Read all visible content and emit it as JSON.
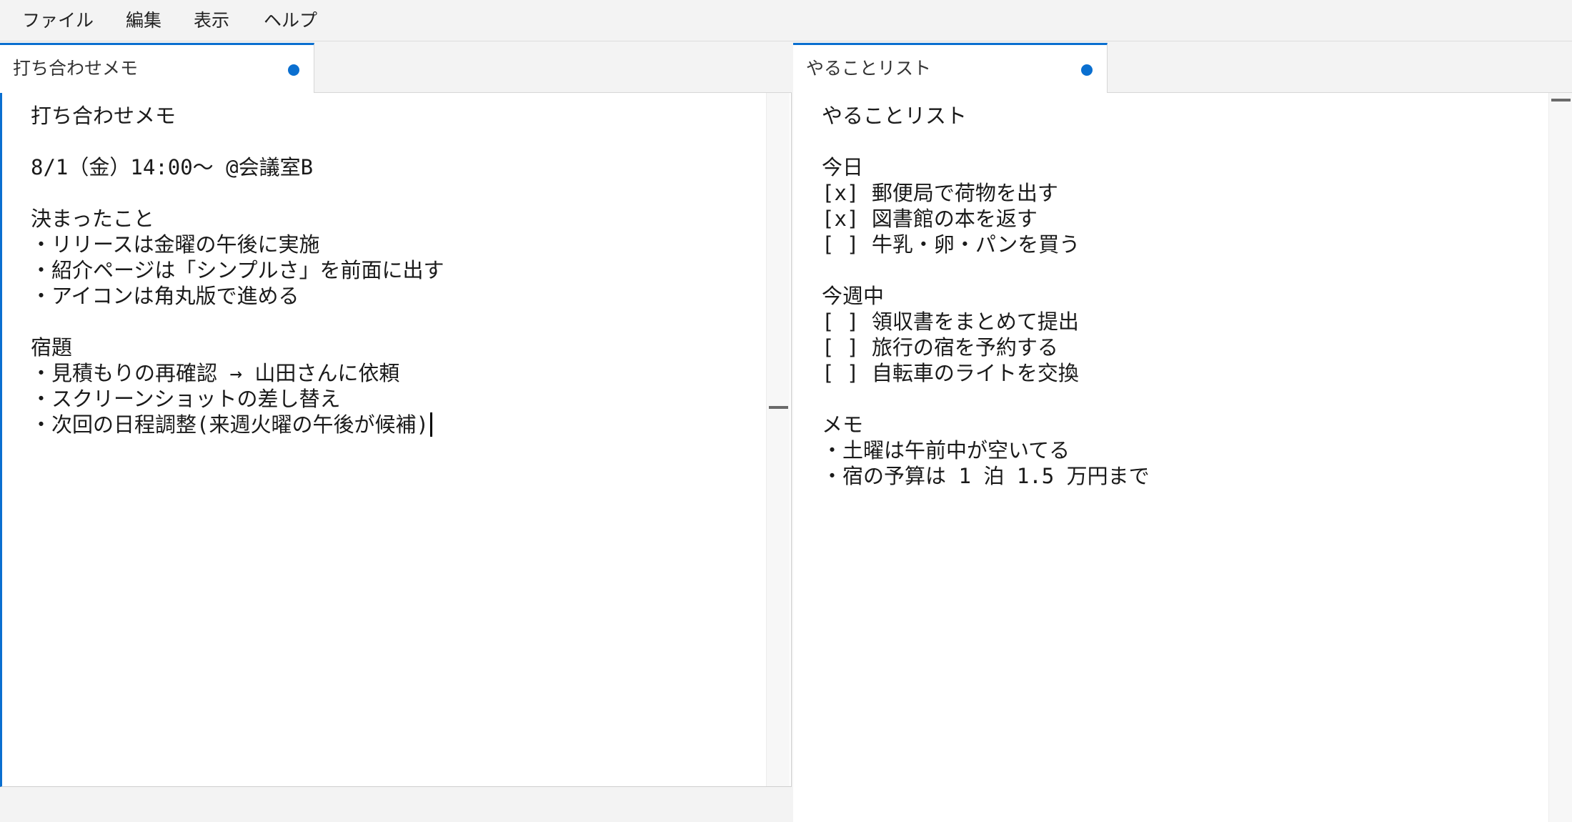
{
  "menu": {
    "file": "ファイル",
    "edit": "編集",
    "view": "表示",
    "help": "ヘルプ"
  },
  "left_pane": {
    "tab_label": "打ち合わせメモ",
    "unsaved": true,
    "content": "打ち合わせメモ\n\n8/1（金）14:00〜 @会議室B\n\n決まったこと\n・リリースは金曜の午後に実施\n・紹介ページは「シンプルさ」を前面に出す\n・アイコンは角丸版で進める\n\n宿題\n・見積もりの再確認 → 山田さんに依頼\n・スクリーンショットの差し替え\n・次回の日程調整(来週火曜の午後が候補)"
  },
  "right_pane": {
    "tab_label": "やることリスト",
    "unsaved": true,
    "content": "やることリスト\n\n今日\n[x] 郵便局で荷物を出す\n[x] 図書館の本を返す\n[ ] 牛乳・卵・パンを買う\n\n今週中\n[ ] 領収書をまとめて提出\n[ ] 旅行の宿を予約する\n[ ] 自転車のライトを交換\n\nメモ\n・土曜は午前中が空いてる\n・宿の予算は 1 泊 1.5 万円まで"
  },
  "colors": {
    "accent": "#0a6fd0",
    "background": "#f3f3f3",
    "editor_background": "#ffffff"
  },
  "icons": {
    "unsaved_indicator": "unsaved-dot-icon"
  }
}
